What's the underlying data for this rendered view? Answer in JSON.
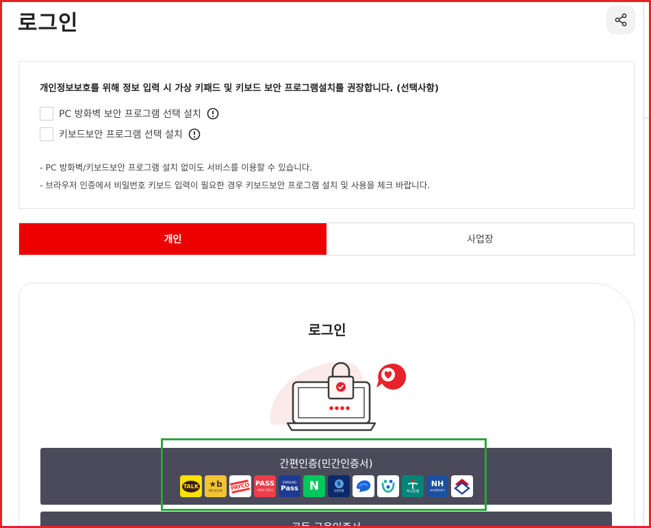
{
  "page": {
    "title": "로그인"
  },
  "share": {
    "icon": "share-icon"
  },
  "notice": {
    "title": "개인정보보호를 위해 정보 입력 시 가상 키패드 및 키보드 보안 프로그램설치를 권장합니다. (선택사항)",
    "options": [
      {
        "label": "PC 방화벽 보안 프로그램 선택 설치",
        "checked": false
      },
      {
        "label": "키보드보안 프로그램 선택 설치",
        "checked": false
      }
    ],
    "notes": [
      "- PC 방화벽/키보드보안 프로그램 설치 없이도 서비스를 이용할 수 있습니다.",
      "- 브라우저 인증에서 비밀번호 키보드 입력이 필요한 경우 키보드보안 프로그램 설치 및 사용을 체크 바랍니다."
    ]
  },
  "tabs": [
    {
      "label": "개인",
      "active": true
    },
    {
      "label": "사업장",
      "active": false
    }
  ],
  "login_card": {
    "heading": "로그인"
  },
  "simple_auth": {
    "label": "간편인증(민간인증서)",
    "providers": [
      {
        "name": "kakao-icon",
        "text": "TALK",
        "bg": "#fae100",
        "fg": "#3c1e1e"
      },
      {
        "name": "kb-icon",
        "text": "★b",
        "sub": "KB국민은행",
        "bg": "#f4c430",
        "fg": "#3b3326"
      },
      {
        "name": "payco-icon",
        "text": "PAYCO",
        "bg": "#ffffff",
        "fg": "#ff2d2d"
      },
      {
        "name": "pass-icon",
        "text": "PASS",
        "sub": "사업자 인증서",
        "bg": "#ee3c48",
        "fg": "#ffffff"
      },
      {
        "name": "samsung-pass-icon",
        "text": "Pass",
        "sub": "SAMSUNG",
        "bg": "#1f3a93",
        "fg": "#ffffff"
      },
      {
        "name": "naver-icon",
        "text": "N",
        "bg": "#03c75a",
        "fg": "#ffffff"
      },
      {
        "name": "shinhan-icon",
        "text": "S",
        "sub": "신한은행",
        "bg": "#0b2a6b",
        "fg": "#ffffff"
      },
      {
        "name": "toss-icon",
        "text": "",
        "bg": "#ffffff",
        "fg": "#1b64da"
      },
      {
        "name": "woori-icon",
        "text": "",
        "bg": "#ffffff",
        "fg": "#2cb3a8"
      },
      {
        "name": "hana-icon",
        "text": "하나은행",
        "bg": "#00857a",
        "fg": "#ffffff"
      },
      {
        "name": "nh-icon",
        "text": "NH",
        "sub": "NH농협인증서",
        "bg": "#1b4fa0",
        "fg": "#ffffff"
      },
      {
        "name": "kfb-icon",
        "text": "",
        "bg": "#ffffff",
        "fg": "#c8102e"
      }
    ]
  },
  "second_auth": {
    "label": "공동·금융인증서"
  },
  "colors": {
    "accent": "#ee0000",
    "auth_button": "#4a4a5a",
    "frame_red": "#e8202a",
    "highlight_green": "#2aa53a"
  }
}
